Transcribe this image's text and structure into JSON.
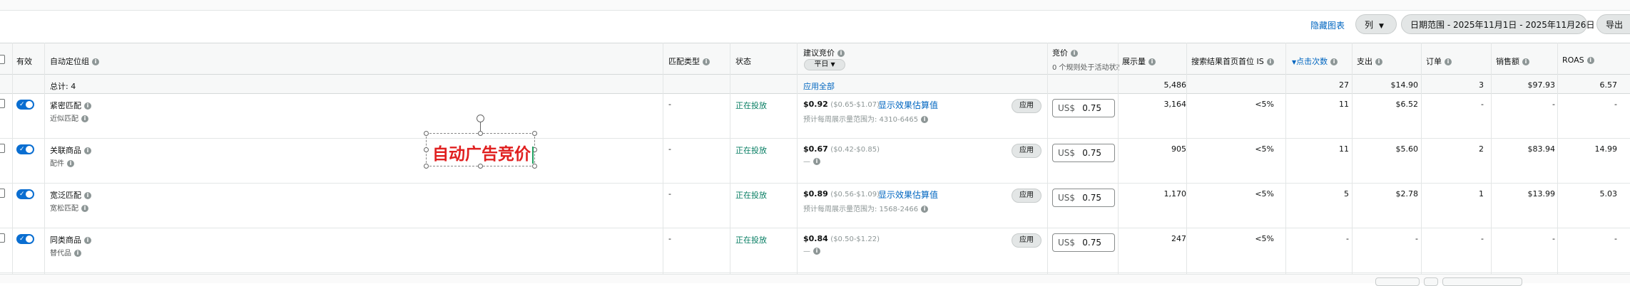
{
  "toolbar": {
    "hide_chart": "隐藏图表",
    "columns": "列",
    "date_range": "日期范围 - 2025年11月1日 - 2025年11月26日",
    "export": "导出"
  },
  "headers": {
    "active": "有效",
    "targeting_group": "自动定位组",
    "match_type": "匹配类型",
    "status": "状态",
    "suggested_bid": "建议竞价",
    "suggested_dropdown": "平日",
    "bid": "竞价",
    "bid_sub": "0 个规则处于活动状态",
    "impressions": "展示量",
    "top_search_is": "搜索结果首页首位 IS",
    "clicks": "点击次数",
    "spend": "支出",
    "orders": "订单",
    "sales": "销售额",
    "roas": "ROAS"
  },
  "totals": {
    "label": "总计: 4",
    "apply_all": "应用全部",
    "impressions": "5,486",
    "clicks": "27",
    "spend": "$14.90",
    "orders": "3",
    "sales": "$97.93",
    "roas": "6.57"
  },
  "rows": [
    {
      "name": "紧密匹配",
      "sub": "近似匹配",
      "match": "-",
      "status": "正在投放",
      "bid_value": "$0.92",
      "bid_range": "($0.65-$1.07)",
      "estimate_link": "显示效果估算值",
      "note": "预计每周展示量范围为: 4310-6465",
      "apply": "应用",
      "currency": "US$",
      "bid": "0.75",
      "impressions": "3,164",
      "top_is": "<5%",
      "clicks": "11",
      "spend": "$6.52",
      "orders": "-",
      "sales": "-",
      "roas": "-"
    },
    {
      "name": "关联商品",
      "sub": "配件",
      "match": "-",
      "status": "正在投放",
      "bid_value": "$0.67",
      "bid_range": "($0.42-$0.85)",
      "estimate_link": "",
      "note": "—",
      "apply": "应用",
      "currency": "US$",
      "bid": "0.75",
      "impressions": "905",
      "top_is": "<5%",
      "clicks": "11",
      "spend": "$5.60",
      "orders": "2",
      "sales": "$83.94",
      "roas": "14.99"
    },
    {
      "name": "宽泛匹配",
      "sub": "宽松匹配",
      "match": "-",
      "status": "正在投放",
      "bid_value": "$0.89",
      "bid_range": "($0.56-$1.09)",
      "estimate_link": "显示效果估算值",
      "note": "预计每周展示量范围为: 1568-2466",
      "apply": "应用",
      "currency": "US$",
      "bid": "0.75",
      "impressions": "1,170",
      "top_is": "<5%",
      "clicks": "5",
      "spend": "$2.78",
      "orders": "1",
      "sales": "$13.99",
      "roas": "5.03"
    },
    {
      "name": "同类商品",
      "sub": "替代品",
      "match": "-",
      "status": "正在投放",
      "bid_value": "$0.84",
      "bid_range": "($0.50-$1.22)",
      "estimate_link": "",
      "note": "—",
      "apply": "应用",
      "currency": "US$",
      "bid": "0.75",
      "impressions": "247",
      "top_is": "<5%",
      "clicks": "-",
      "spend": "-",
      "orders": "-",
      "sales": "-",
      "roas": "-"
    }
  ],
  "overlay": {
    "text": "自动广告竞价"
  }
}
